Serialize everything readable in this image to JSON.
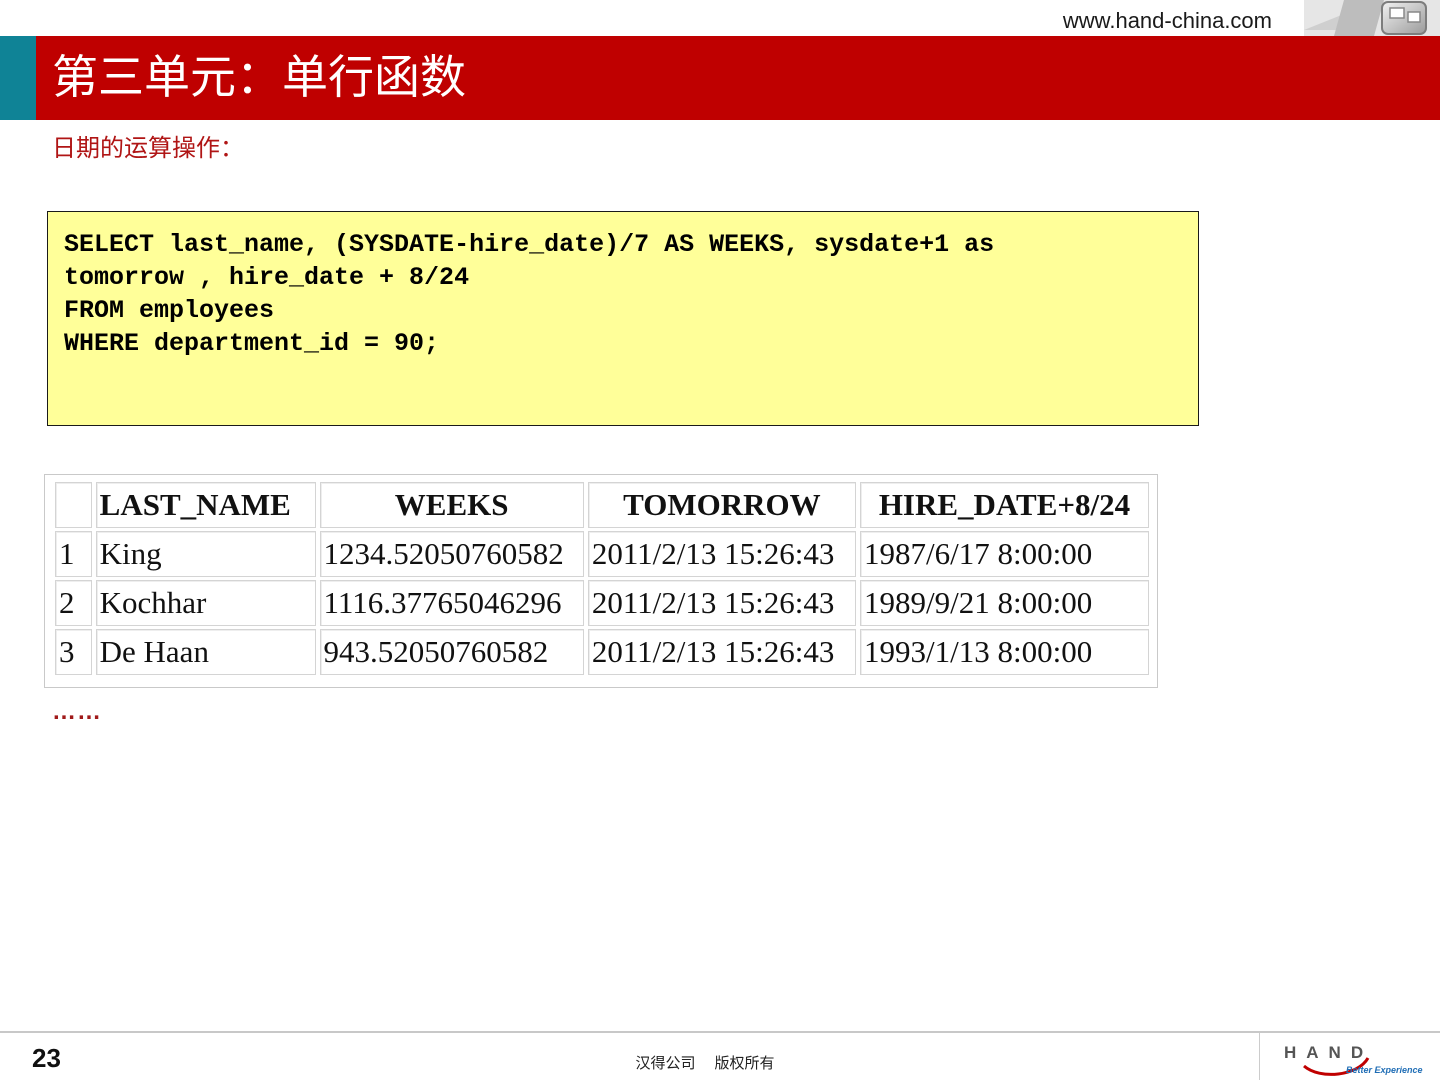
{
  "header": {
    "site_url": "www.hand-china.com",
    "title": "第三单元：单行函数",
    "accent_color": "#bf0000",
    "side_color": "#0f8396"
  },
  "content": {
    "subtitle": "日期的运算操作：",
    "code_lines": [
      "SELECT last_name, (SYSDATE-hire_date)/7 AS WEEKS, sysdate+1 as",
      "tomorrow , hire_date + 8/24",
      "FROM employees",
      "WHERE department_id = 90;"
    ],
    "result_table": {
      "columns": [
        "",
        "LAST_NAME",
        "WEEKS",
        "TOMORROW",
        "HIRE_DATE+8/24"
      ],
      "rows": [
        [
          "1",
          "King",
          "1234.52050760582",
          "2011/2/13 15:26:43",
          "1987/6/17 8:00:00"
        ],
        [
          "2",
          "Kochhar",
          "1116.37765046296",
          "2011/2/13 15:26:43",
          "1989/9/21 8:00:00"
        ],
        [
          "3",
          "De Haan",
          "943.52050760582",
          "2011/2/13 15:26:43",
          "1993/1/13 8:00:00"
        ]
      ]
    },
    "ellipsis": "……"
  },
  "footer": {
    "page_number": "23",
    "copyright": "汉得公司    版权所有",
    "logo_text": "HAND",
    "logo_tagline": "Better Experience"
  }
}
